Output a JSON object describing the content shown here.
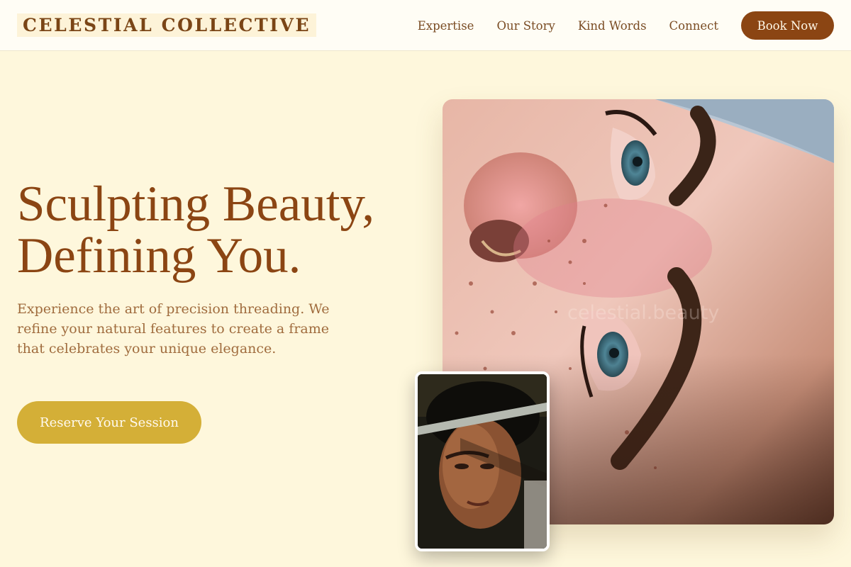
{
  "header": {
    "logo": "CELESTIAL COLLECTIVE",
    "nav": [
      "Expertise",
      "Our Story",
      "Kind Words",
      "Connect"
    ],
    "book_label": "Book Now"
  },
  "hero": {
    "title_line1": "Sculpting Beauty,",
    "title_line2": "Defining You.",
    "subtitle": "Experience the art of precision threading. We refine your natural features to create a frame that celebrates your unique elegance.",
    "cta_label": "Reserve Your Session"
  },
  "images": {
    "main_alt": "Close-up of a freckled face with shaped eyebrows",
    "main_watermark": "celestial.beauty",
    "small_alt": "Woman receiving threading treatment"
  },
  "colors": {
    "background": "#fef7dc",
    "brand_brown": "#8b4513",
    "gold": "#d4af37",
    "text_muted": "#a06c3e"
  }
}
